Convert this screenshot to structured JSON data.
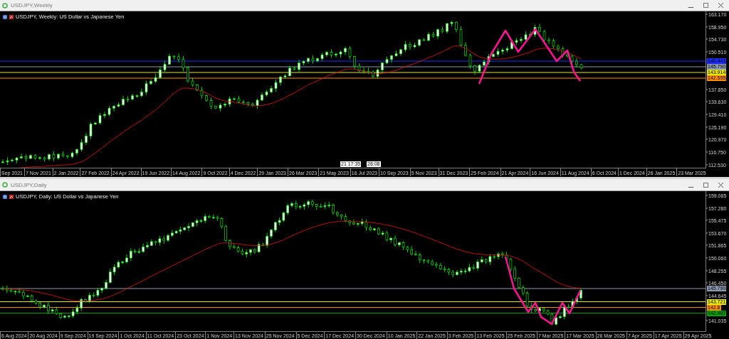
{
  "windows": [
    {
      "title": "USDJPY,Weekly",
      "chart_label": "USDJPY, Weekly: US Dollar vs Japanese Yen",
      "kind": "weekly",
      "price_ticks": [
        "163.170",
        "158.950",
        "154.730",
        "150.510",
        "137.850",
        "133.630",
        "129.410",
        "125.190",
        "120.970",
        "116.750",
        "112.530"
      ],
      "price_tags": [
        {
          "text": "146.441",
          "color": "#1c2cff"
        },
        {
          "text": "145.790",
          "color": "#8c9aae"
        },
        {
          "text": "143.914",
          "color": "#e8e800"
        },
        {
          "text": "142.595",
          "color": "#ff8c00"
        }
      ],
      "time_labels": [
        "Sep 2021",
        "7 Nov 2021",
        "2 Jan 2022",
        "27 Feb 2022",
        "24 Apr 2022",
        "19 Jun 2022",
        "14 Aug 2022",
        "9 Oct 2022",
        "4 Dec 2022",
        "29 Jan 2023",
        "26 Mar 2023",
        "21 May 2023",
        "16 Jul 2023",
        "10 Sep 2023",
        "5 Nov 2023",
        "31 Dec 2023",
        "25 Feb 2024",
        "21 Apr 2024",
        "16 Jun 2024",
        "11 Aug 2024",
        "6 Oct 2024",
        "1 Dec 2024",
        "26 Jan 2025",
        "23 Mar 2025"
      ],
      "time_markers": [
        "21 17:35",
        "28:08"
      ]
    },
    {
      "title": "USDJPY,Daily",
      "chart_label": "USDJPY, Daily: US Dollar vs Japanese Yen",
      "kind": "daily",
      "price_ticks": [
        "159.085",
        "157.280",
        "155.475",
        "153.670",
        "151.865",
        "150.060",
        "148.255",
        "146.450",
        "144.645",
        "141.035"
      ],
      "price_tags": [
        {
          "text": "145.790",
          "color": "#8c9aae"
        },
        {
          "text": "143.721",
          "color": "#e8e800"
        },
        {
          "text": "142.8",
          "color": "#ff8c00"
        },
        {
          "text": "142.487",
          "color": "#00a000"
        }
      ],
      "time_labels": [
        "6 Aug 2024",
        "20 Aug 2024",
        "9 Sep 2024",
        "19 Sep 2024",
        "1 Oct 2024",
        "11 Oct 2024",
        "23 Oct 2024",
        "1 Nov 2024",
        "13 Nov 2024",
        "25 Nov 2024",
        "5 Dec 2024",
        "17 Dec 2024",
        "30 Dec 2024",
        "10 Jan 2025",
        "22 Jan 2025",
        "3 Feb 2025",
        "13 Feb 2025",
        "25 Feb 2025",
        "7 Mar 2025",
        "17 Mar 2025",
        "26 Mar 2025",
        "7 Apr 2025",
        "17 Apr 2025",
        "29 Apr 2025"
      ]
    }
  ]
}
